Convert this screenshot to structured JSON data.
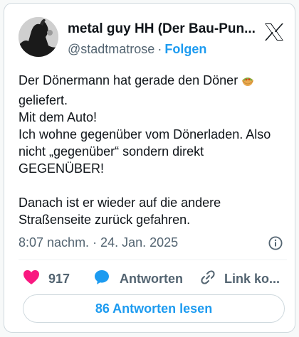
{
  "author": {
    "name": "metal guy HH (Der Bau-Pun...",
    "handle": "@stadtmatrose",
    "separator": "·",
    "follow_label": "Folgen"
  },
  "tweet": {
    "lines": [
      "Der Dönermann hat gerade den Döner",
      "geliefert.",
      "Mit dem Auto!",
      "Ich wohne gegenüber vom Dönerladen. Also",
      "nicht „gegenüber“ sondern direkt",
      "GEGENÜBER!",
      "",
      "Danach ist er wieder auf die andere",
      "Straßenseite zurück gefahren."
    ],
    "emoji": "stuffed-flatbread-emoji",
    "timestamp": "8:07 nachm. · 24. Jan. 2025"
  },
  "actions": {
    "like_count": "917",
    "reply_label": "Antworten",
    "link_label": "Link ko..."
  },
  "read_replies_label": "86 Antworten lesen",
  "colors": {
    "accent": "#1d9bf0",
    "like": "#f91880",
    "secondary_text": "#536471",
    "border": "#cfd9de"
  },
  "icons": [
    "x-logo-icon",
    "info-icon",
    "heart-icon",
    "reply-bubble-icon",
    "link-icon"
  ]
}
